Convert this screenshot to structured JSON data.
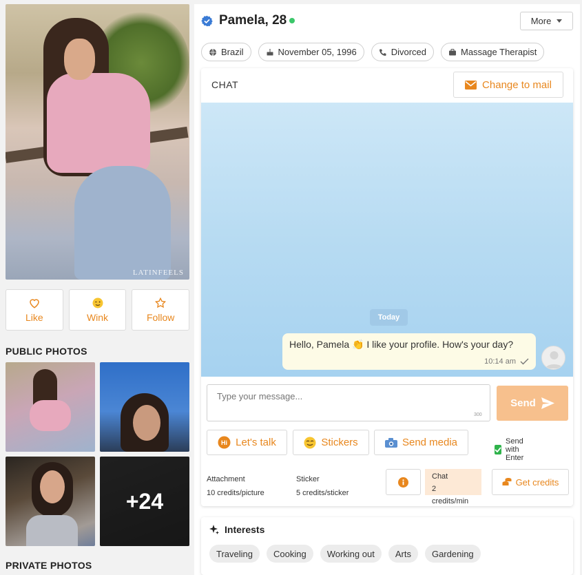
{
  "profile": {
    "name": "Pamela, 28",
    "online": true,
    "main_photo_watermark": "LATINFEELS",
    "chips": [
      {
        "icon": "globe-icon",
        "label": "Brazil"
      },
      {
        "icon": "birthday-cake-icon",
        "label": "November 05, 1996"
      },
      {
        "icon": "relationship-icon",
        "label": "Divorced"
      },
      {
        "icon": "briefcase-icon",
        "label": "Massage Therapist"
      }
    ],
    "more_label": "More"
  },
  "actions": {
    "like": "Like",
    "wink": "Wink",
    "follow": "Follow"
  },
  "photos": {
    "public_title": "PUBLIC PHOTOS",
    "more_count": "+24",
    "private_title": "PRIVATE PHOTOS"
  },
  "chat": {
    "title": "CHAT",
    "change_to_mail": "Change to mail",
    "date_divider": "Today",
    "messages": [
      {
        "text": "Hello, Pamela 👏 I like your profile. How's your day?",
        "time": "10:14 am",
        "status": "sent"
      }
    ],
    "input_placeholder": "Type your message...",
    "char_counter": "300",
    "send_label": "Send",
    "lets_talk": "Let's talk",
    "stickers": "Stickers",
    "send_media": "Send media",
    "send_with_enter": "Send with Enter",
    "send_with_enter_checked": true
  },
  "credits": {
    "attachment_title": "Attachment",
    "attachment_price": "10 credits/picture",
    "sticker_title": "Sticker",
    "sticker_price": "5 credits/sticker",
    "chat_title": "Chat",
    "chat_price": "2 credits/min",
    "get_credits": "Get credits"
  },
  "interests": {
    "title": "Interests",
    "tags": [
      "Traveling",
      "Cooking",
      "Working out",
      "Arts",
      "Gardening"
    ]
  },
  "colors": {
    "accent": "#e8871e",
    "online": "#3cc76a",
    "verified": "#3a7bd5",
    "send_disabled": "#f7c08d"
  }
}
